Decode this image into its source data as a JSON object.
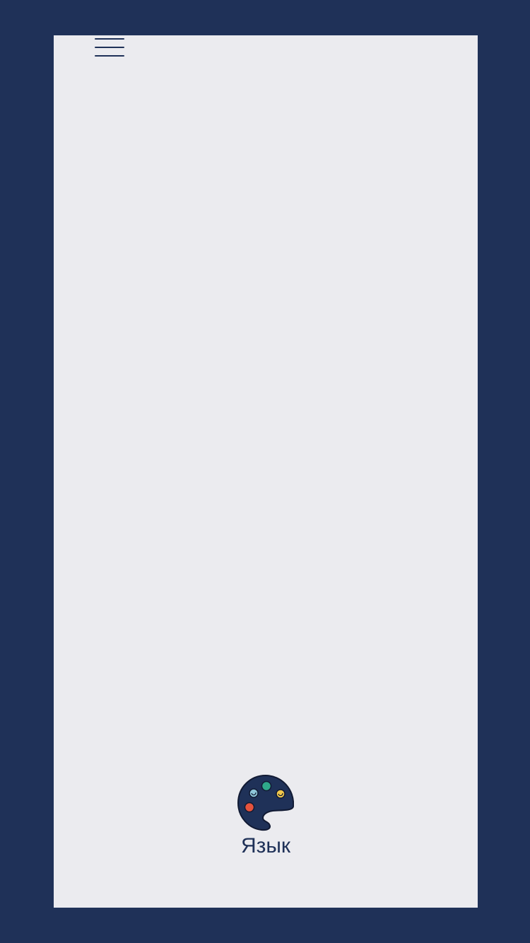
{
  "menu": {
    "icon": "hamburger-menu-icon"
  },
  "language_item": {
    "icon": "palette-icon",
    "label": "Язык"
  },
  "colors": {
    "frame": "#1f3158",
    "screen_bg": "#ebebef",
    "accent": "#1f3158",
    "palette_dots": [
      "#8ec6d9",
      "#2fa98a",
      "#f2c94c",
      "#e5533d"
    ]
  }
}
